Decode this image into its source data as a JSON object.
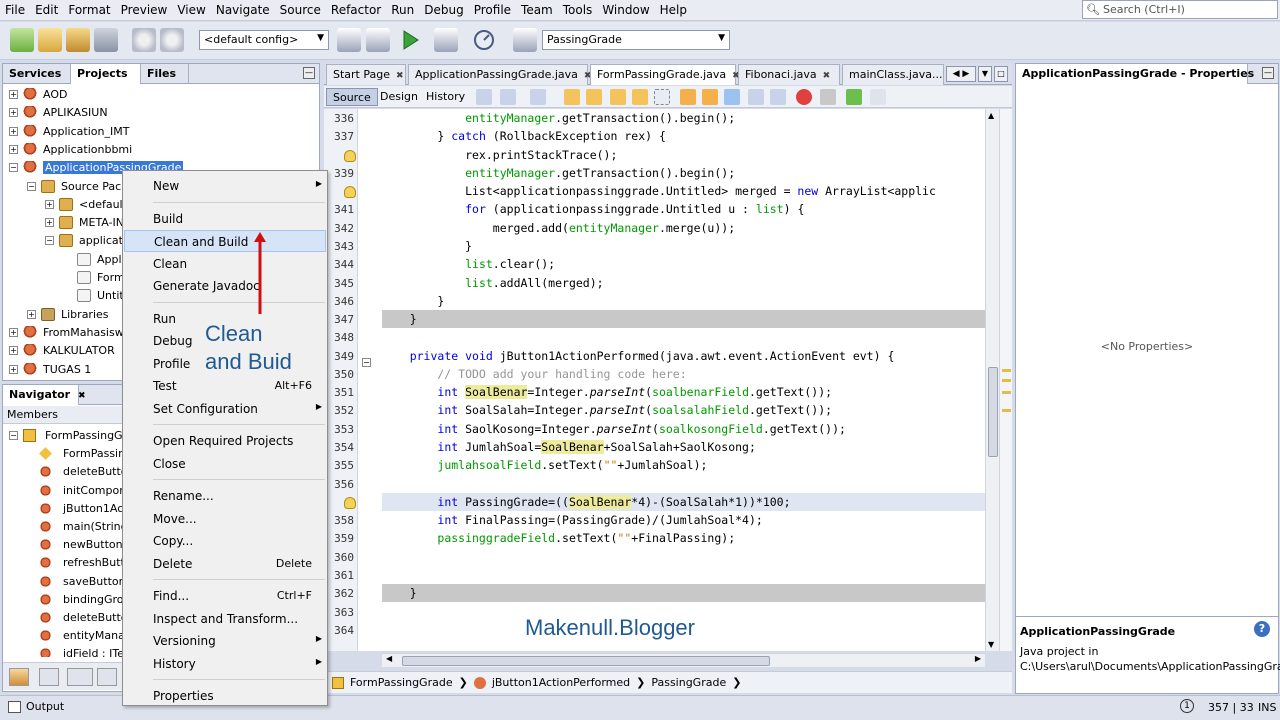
{
  "menubar": {
    "items": [
      "File",
      "Edit",
      "Format",
      "Preview",
      "View",
      "Navigate",
      "Source",
      "Refactor",
      "Run",
      "Debug",
      "Profile",
      "Team",
      "Tools",
      "Window",
      "Help"
    ],
    "search_placeholder": "Search (Ctrl+I)"
  },
  "toolbar": {
    "config": "<default config>",
    "project": "PassingGrade"
  },
  "projects_panel": {
    "tabs": [
      "Services",
      "Projects",
      "Files"
    ],
    "tree": [
      {
        "label": "AOD",
        "indent": 0,
        "icon": "project-icon"
      },
      {
        "label": "APLIKASIUN",
        "indent": 0,
        "icon": "project-icon"
      },
      {
        "label": "Application_IMT",
        "indent": 0,
        "icon": "project-icon"
      },
      {
        "label": "Applicationbbmi",
        "indent": 0,
        "icon": "project-icon"
      },
      {
        "label": "ApplicationPassingGrade",
        "indent": 0,
        "icon": "project-icon"
      },
      {
        "label": "Source Packa",
        "indent": 1,
        "icon": "package-icon"
      },
      {
        "label": "<default",
        "indent": 2,
        "icon": "package-icon"
      },
      {
        "label": "META-IN",
        "indent": 2,
        "icon": "package-icon"
      },
      {
        "label": "applicatio",
        "indent": 2,
        "icon": "package-icon"
      },
      {
        "label": "Appli",
        "indent": 3,
        "icon": "file-icon"
      },
      {
        "label": "Form",
        "indent": 3,
        "icon": "file-icon"
      },
      {
        "label": "Untitl",
        "indent": 3,
        "icon": "file-icon"
      },
      {
        "label": "Libraries",
        "indent": 1,
        "icon": "library-icon"
      },
      {
        "label": "FromMahasiswa",
        "indent": 0,
        "icon": "project-icon"
      },
      {
        "label": "KALKULATOR",
        "indent": 0,
        "icon": "project-icon"
      },
      {
        "label": "TUGAS 1",
        "indent": 0,
        "icon": "project-icon"
      }
    ]
  },
  "navigator_panel": {
    "tab": "Navigator",
    "members_label": "Members",
    "items": [
      "FormPassingGrad",
      "FormPassingG",
      "deleteButton",
      "initComponen",
      "jButton1Actio",
      "main(String[]",
      "newButtonAc",
      "refreshButto",
      "saveButtonA",
      "bindingGroup",
      "deleteButton",
      "entityManage",
      "idField : JTex"
    ]
  },
  "context_menu": {
    "items": [
      {
        "label": "New",
        "shortcut": "",
        "submenu": true
      },
      {
        "label": "Build",
        "shortcut": "",
        "submenu": false
      },
      {
        "label": "Clean and Build",
        "shortcut": "",
        "submenu": false,
        "selected": true
      },
      {
        "label": "Clean",
        "shortcut": "",
        "submenu": false
      },
      {
        "label": "Generate Javadoc",
        "shortcut": "",
        "submenu": false
      },
      {
        "label": "Run",
        "shortcut": "",
        "submenu": false
      },
      {
        "label": "Debug",
        "shortcut": "",
        "submenu": false
      },
      {
        "label": "Profile",
        "shortcut": "",
        "submenu": false
      },
      {
        "label": "Test",
        "shortcut": "Alt+F6",
        "submenu": false
      },
      {
        "label": "Set Configuration",
        "shortcut": "",
        "submenu": true
      },
      {
        "label": "Open Required Projects",
        "shortcut": "",
        "submenu": false
      },
      {
        "label": "Close",
        "shortcut": "",
        "submenu": false
      },
      {
        "label": "Rename...",
        "shortcut": "",
        "submenu": false
      },
      {
        "label": "Move...",
        "shortcut": "",
        "submenu": false
      },
      {
        "label": "Copy...",
        "shortcut": "",
        "submenu": false
      },
      {
        "label": "Delete",
        "shortcut": "Delete",
        "submenu": false
      },
      {
        "label": "Find...",
        "shortcut": "Ctrl+F",
        "submenu": false
      },
      {
        "label": "Inspect and Transform...",
        "shortcut": "",
        "submenu": false
      },
      {
        "label": "Versioning",
        "shortcut": "",
        "submenu": true
      },
      {
        "label": "History",
        "shortcut": "",
        "submenu": true
      },
      {
        "label": "Properties",
        "shortcut": "",
        "submenu": false
      }
    ]
  },
  "annotation": {
    "line1": "Clean",
    "line2": "and Buid"
  },
  "editor": {
    "tabs": [
      "Start Page",
      "ApplicationPassingGrade.java",
      "FormPassingGrade.java",
      "Fibonaci.java",
      "mainClass.java..."
    ],
    "active_tab": "FormPassingGrade.java",
    "view_tabs": [
      "Source",
      "Design",
      "History"
    ],
    "line_numbers": [
      "336",
      "337",
      "",
      "339",
      "",
      "341",
      "342",
      "343",
      "344",
      "345",
      "346",
      "347",
      "348",
      "349",
      "350",
      "351",
      "352",
      "353",
      "354",
      "355",
      "356",
      "",
      "358",
      "359",
      "360",
      "361",
      "362",
      "363",
      "364"
    ],
    "code_lines": [
      "            entityManager.getTransaction().begin();",
      "        } catch (RollbackException rex) {",
      "            rex.printStackTrace();",
      "            entityManager.getTransaction().begin();",
      "            List<applicationpassinggrade.Untitled> merged = new ArrayList<applic",
      "            for (applicationpassinggrade.Untitled u : list) {",
      "                merged.add(entityManager.merge(u));",
      "            }",
      "            list.clear();",
      "            list.addAll(merged);",
      "        }",
      "    }",
      "",
      "    private void jButton1ActionPerformed(java.awt.event.ActionEvent evt) {",
      "        // TODO add your handling code here:",
      "        int SoalBenar=Integer.parseInt(soalbenarField.getText());",
      "        int SoalSalah=Integer.parseInt(soalsalahField.getText());",
      "        int SaolKosong=Integer.parseInt(soalkosongField.getText());",
      "        int JumlahSoal=SoalBenar+SoalSalah+SaolKosong;",
      "        jumlahsoalField.setText(\"\"+JumlahSoal);",
      "",
      "        int PassingGrade=((SoalBenar*4)-(SoalSalah*1))*100;",
      "        int FinalPassing=(PassingGrade)/(JumlahSoal*4);",
      "        passinggradeField.setText(\"\"+FinalPassing);",
      "",
      "",
      "    }",
      "",
      ""
    ],
    "breadcrumb": [
      "FormPassingGrade",
      "jButton1ActionPerformed",
      "PassingGrade"
    ]
  },
  "watermark": "Makenull.Blogger",
  "properties_panel": {
    "title": "ApplicationPassingGrade - Properties",
    "empty_text": "<No Properties>",
    "desc_title": "ApplicationPassingGrade",
    "desc_line1": "Java project in",
    "desc_line2": "C:\\Users\\arul\\Documents\\ApplicationPassingGrade"
  },
  "statusbar": {
    "output_label": "Output",
    "position": "357 | 33",
    "mode": "INS"
  },
  "colors": {
    "keyword": "#0000e6",
    "field": "#009900",
    "comment": "#969696",
    "annotation": "#1f5a93",
    "arrow": "#d01010",
    "selection": "#3a78d6"
  }
}
